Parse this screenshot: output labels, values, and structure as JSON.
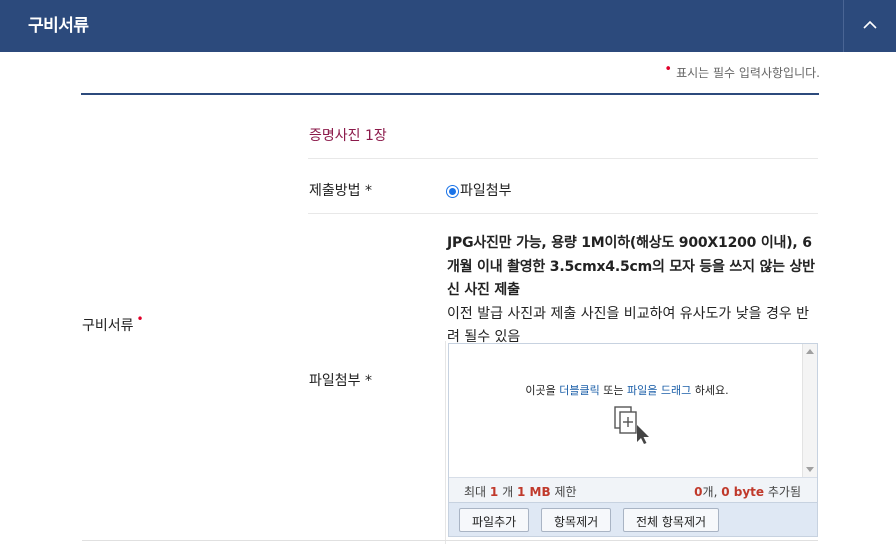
{
  "header": {
    "title": "구비서류",
    "toggle_icon": "chevron-up-icon"
  },
  "required_note": {
    "marker": "•",
    "text": "표시는 필수 입력사항입니다."
  },
  "section": {
    "label": "구비서류",
    "required_marker": "•"
  },
  "photo": {
    "title": "증명사진 1장",
    "method_label": "제출방법 *",
    "method_option": "파일첨부",
    "attach_label": "파일첨부 *",
    "description_line1": "JPG사진만 가능, 용량 1M이하(해상도 900X1200 이내), 6개월 이내 촬영한 3.5cmx4.5cm의 모자 등을 쓰지 않는 상반신 사진 제출",
    "description_line2": "이전 발급 사진과 제출 사진을 비교하여 유사도가 낮을 경우 반려 될수 있음"
  },
  "uploader": {
    "drop_prefix": "이곳을 ",
    "drop_link1": "더블클릭",
    "drop_mid": " 또는 ",
    "drop_link2": "파일을 드래그",
    "drop_suffix": " 하세요.",
    "limit_prefix": "최대",
    "limit_count": "1",
    "limit_unit1": "개",
    "limit_size": "1 MB",
    "limit_suffix": "제한",
    "added_count": "0",
    "added_unit": "개,",
    "added_size": "0 byte",
    "added_suffix": "추가됨",
    "btn_add": "파일추가",
    "btn_remove": "항목제거",
    "btn_remove_all": "전체 항목제거"
  },
  "colors": {
    "header_bg": "#2c4a7c",
    "accent_title": "#8b1a4a",
    "required_red": "#e0002a",
    "link_blue": "#1a5ea8"
  }
}
